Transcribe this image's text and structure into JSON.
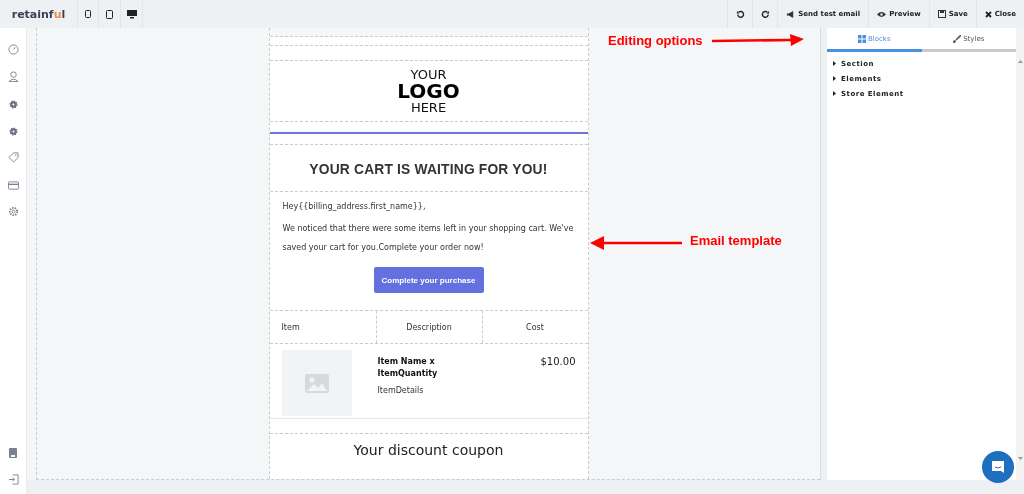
{
  "topbar": {
    "logo": [
      {
        "text": "retainf",
        "accent": false
      },
      {
        "text": "u",
        "accent": true
      },
      {
        "text": "l",
        "accent": false
      }
    ],
    "devices": [
      {
        "kind": "mobile"
      },
      {
        "kind": "tablet"
      },
      {
        "kind": "desktop"
      }
    ],
    "history": [
      {
        "kind": "undo"
      },
      {
        "kind": "redo"
      }
    ],
    "actions": [
      {
        "label": "Send test email",
        "kind": "send"
      },
      {
        "label": "Preview",
        "kind": "eye"
      },
      {
        "label": "Save",
        "kind": "disk"
      },
      {
        "label": "Close",
        "kind": "close"
      }
    ]
  },
  "sidebar": {
    "items": [
      {
        "kind": "gauge"
      },
      {
        "kind": "user"
      },
      {
        "kind": "gear"
      },
      {
        "kind": "gear"
      },
      {
        "kind": "tag"
      },
      {
        "kind": "card"
      },
      {
        "kind": "settings"
      }
    ],
    "bottom": [
      {
        "kind": "book"
      },
      {
        "kind": "logout"
      }
    ]
  },
  "email": {
    "logo_lines": [
      "YOUR",
      "LOGO",
      "HERE"
    ],
    "heading": "YOUR CART IS WAITING FOR YOU!",
    "greeting": "Hey{{billing_address.first_name}},",
    "message": "We noticed that there were some items left in your shopping cart. We've saved your cart for you.Complete your order now!",
    "button": "Complete your purchase",
    "table": {
      "columns": [
        "Item",
        "Description",
        "Cost"
      ],
      "rows": [
        {
          "name": "Item Name x ItemQuantity",
          "details": "ItemDetails",
          "cost": "$10.00"
        }
      ]
    },
    "coupon_heading": "Your discount coupon"
  },
  "panel": {
    "tabs": [
      {
        "label": "Blocks",
        "selected": true,
        "kind": "grid"
      },
      {
        "label": "Styles",
        "selected": false,
        "kind": "brush"
      }
    ],
    "blocks": [
      "Section",
      "Elements",
      "Store Element"
    ]
  },
  "annotations": [
    {
      "text": "Editing options"
    },
    {
      "text": "Email template"
    }
  ]
}
